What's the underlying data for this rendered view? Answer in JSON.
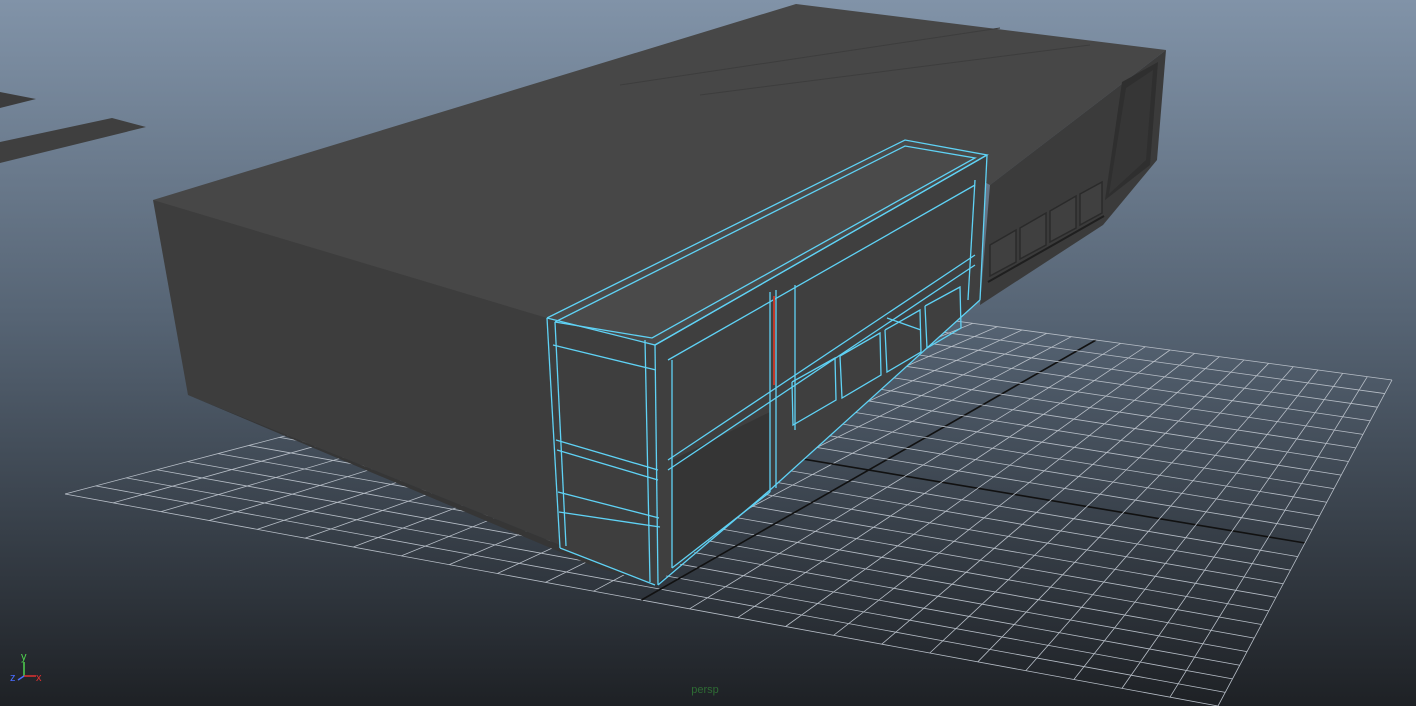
{
  "viewport": {
    "camera_label": "persp",
    "background_top": "#8193a8",
    "background_bottom": "#1e2125",
    "grid_color": "#b7bec7",
    "grid_axis_color": "#111111",
    "selection_color": "#5fd2f5",
    "manipulator_color": "#c0392b",
    "mesh_top_color": "#464646",
    "mesh_side_color": "#3a3a3a"
  },
  "axis_gizmo": {
    "x_label": "x",
    "y_label": "y",
    "z_label": "z",
    "x_color": "#e03030",
    "y_color": "#4fd24f",
    "z_color": "#4a6cff"
  },
  "icons": [
    "axis-gizmo-icon"
  ]
}
